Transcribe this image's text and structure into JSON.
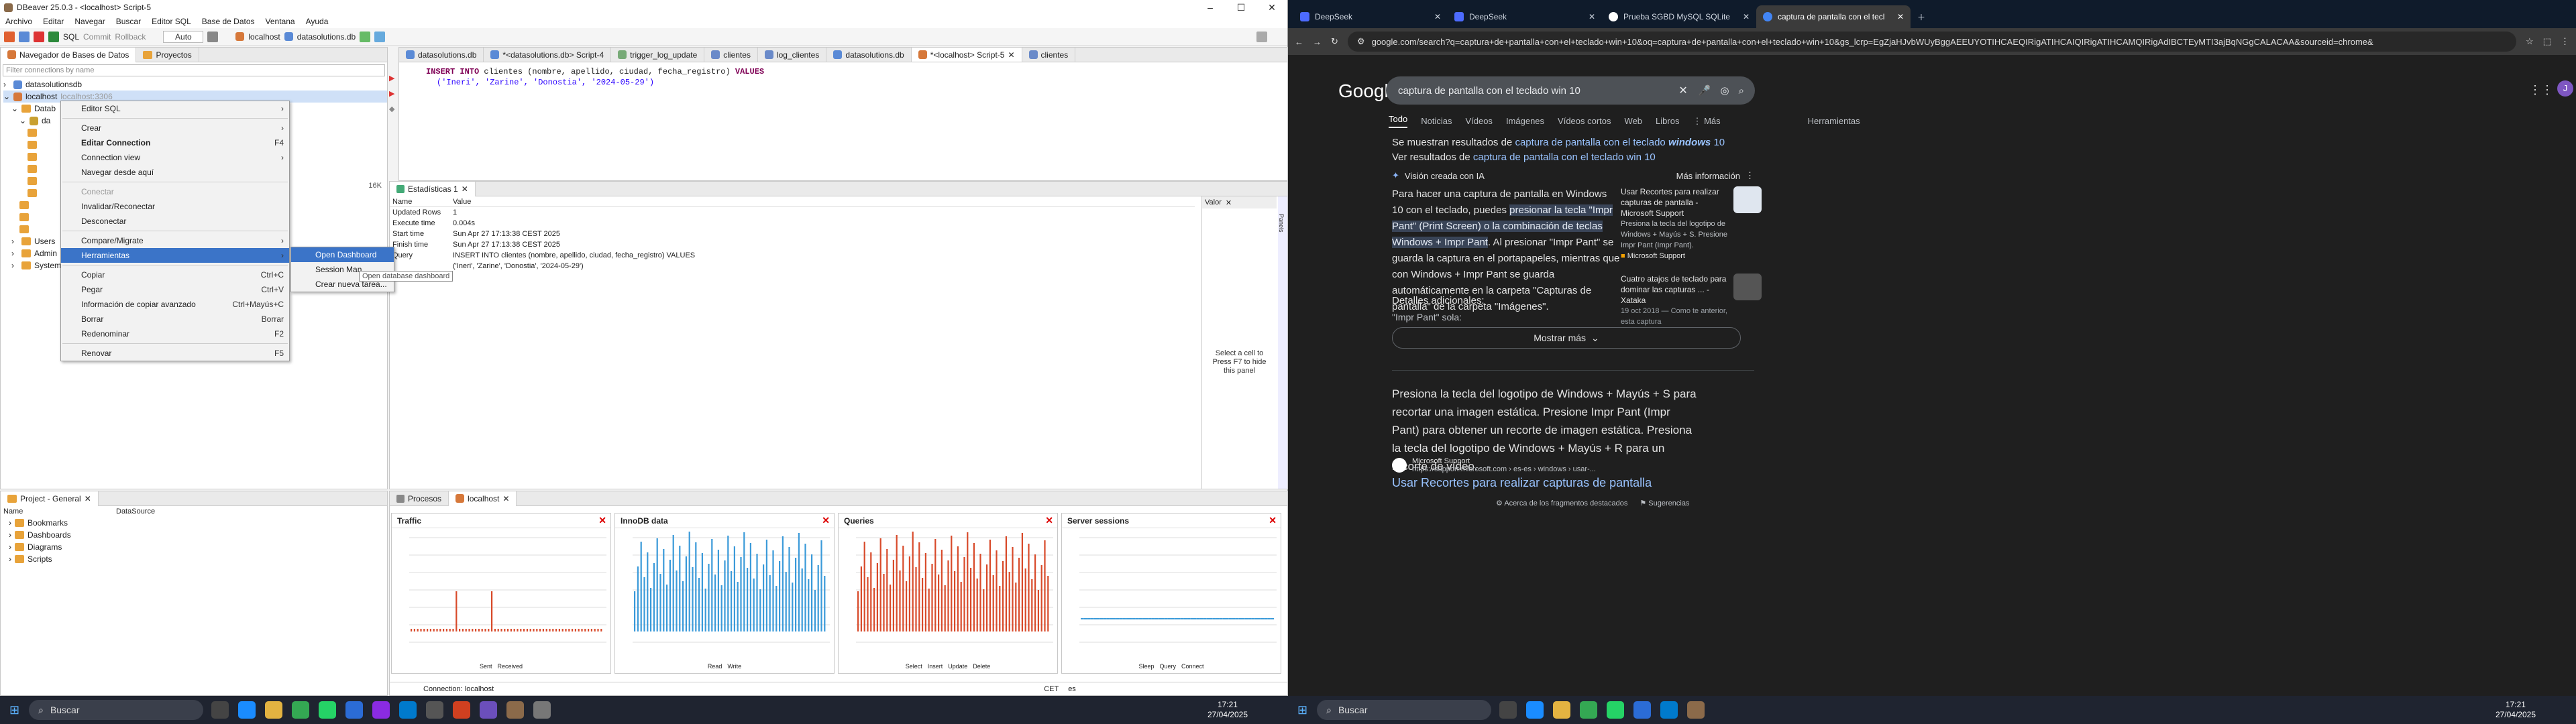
{
  "dbeaver": {
    "title": "DBeaver 25.0.3 - <localhost> Script-5",
    "menu": [
      "Archivo",
      "Editar",
      "Navegar",
      "Buscar",
      "Editor SQL",
      "Base de Datos",
      "Ventana",
      "Ayuda"
    ],
    "toolbar": {
      "sql": "SQL",
      "commit": "Commit",
      "rollback": "Rollback",
      "auto": "Auto",
      "conn": "localhost",
      "db": "datasolutions.db"
    },
    "nav": {
      "tab1": "Navegador de Bases de Datos",
      "tab2": "Proyectos",
      "filter": "Filter connections by name",
      "items": [
        "datasolutionsdb",
        "localhost",
        "Datab",
        "da",
        "Users",
        "Admin",
        "System"
      ],
      "localhost_suffix": "localhost:3306"
    },
    "editor_tabs": [
      "datasolutions.db",
      "*<datasolutions.db> Script-4",
      "trigger_log_update",
      "clientes",
      "log_clientes",
      "datasolutions.db",
      "*<localhost> Script-5",
      "clientes"
    ],
    "code": {
      "line1_kw": "INSERT INTO",
      "line1": " clientes (nombre, apellido, ciudad, fecha_registro) ",
      "line1_kw2": "VALUES",
      "line2": "('Ineri', 'Zarine', 'Donostia', '2024-05-29')"
    },
    "stats": {
      "tab": "Estadísticas 1",
      "col_name": "Name",
      "col_value": "Value",
      "rows": [
        [
          "Updated Rows",
          "1"
        ],
        [
          "Execute time",
          "0.004s"
        ],
        [
          "Start time",
          "Sun Apr 27 17:13:38 CEST 2025"
        ],
        [
          "Finish time",
          "Sun Apr 27 17:13:38 CEST 2025"
        ],
        [
          "Query",
          "INSERT INTO clientes (nombre, apellido, ciudad, fecha_registro) VALUES"
        ],
        [
          "",
          "('Ineri', 'Zarine', 'Donostia', '2024-05-29')"
        ]
      ],
      "value_tab": "Valor",
      "hint": "Select a cell to",
      "hint2": "Press F7 to hide",
      "hint3": "this panel",
      "side": "Panels",
      "size": "16K"
    },
    "ctx": {
      "items": [
        {
          "label": "Editor SQL",
          "sub": true
        },
        {
          "sep": true
        },
        {
          "label": "Crear",
          "sub": true
        },
        {
          "label": "Editar Connection",
          "sc": "F4",
          "bold": true
        },
        {
          "label": "Connection view",
          "sub": true
        },
        {
          "label": "Navegar desde aquí"
        },
        {
          "sep": true
        },
        {
          "label": "Conectar",
          "dis": true
        },
        {
          "label": "Invalidar/Reconectar"
        },
        {
          "label": "Desconectar"
        },
        {
          "sep": true
        },
        {
          "label": "Compare/Migrate",
          "sub": true
        },
        {
          "label": "Herramientas",
          "sub": true,
          "hl": true
        },
        {
          "sep": true
        },
        {
          "label": "Copiar",
          "sc": "Ctrl+C"
        },
        {
          "label": "Pegar",
          "sc": "Ctrl+V"
        },
        {
          "label": "Información de copiar avanzado",
          "sc": "Ctrl+Mayús+C"
        },
        {
          "label": "Borrar",
          "sc": "Borrar"
        },
        {
          "label": "Redenominar",
          "sc": "F2"
        },
        {
          "sep": true
        },
        {
          "label": "Renovar",
          "sc": "F5"
        }
      ],
      "sub": [
        "Open Dashboard",
        "Session Man",
        "Crear nueva tarea..."
      ],
      "tooltip": "Open database dashboard"
    },
    "project": {
      "tab": "Project - General",
      "col1": "Name",
      "col2": "DataSource",
      "items": [
        "Bookmarks",
        "Dashboards",
        "Diagrams",
        "Scripts"
      ]
    },
    "dash": {
      "tab1": "Procesos",
      "tab2": "localhost",
      "conn": "Connection: localhost",
      "cet": "CET",
      "lang": "es"
    },
    "charts": [
      {
        "title": "Traffic",
        "legend": [
          "Sent",
          "Received"
        ],
        "color": "#d84a2a"
      },
      {
        "title": "InnoDB data",
        "legend": [
          "Read",
          "Write"
        ],
        "color": "#3a9ad9"
      },
      {
        "title": "Queries",
        "legend": [
          "Select",
          "Insert",
          "Update",
          "Delete"
        ],
        "color": "#d84a2a"
      },
      {
        "title": "Server sessions",
        "legend": [
          "Sleep",
          "Query",
          "Connect"
        ],
        "color": "#3a9ad9"
      }
    ]
  },
  "chrome": {
    "tabs": [
      "DeepSeek",
      "DeepSeek",
      "Prueba SGBD MySQL SQLite",
      "captura de pantalla con el tecla"
    ],
    "url": "google.com/search?q=captura+de+pantalla+con+el+teclado+win+10&oq=captura+de+pantalla+con+el+teclado+win+10&gs_lcrp=EgZjaHJvbWUyBggAEEUYOTIHCAEQIRigATIHCAIQIRigATIHCAMQIRigAdIBCTEyMTI3ajBqNGgCALACAA&sourceid=chrome&",
    "query": "captura de pantalla con el teclado win 10",
    "filters": [
      "Todo",
      "Noticias",
      "Vídeos",
      "Imágenes",
      "Vídeos cortos",
      "Web",
      "Libros",
      "⋮ Más",
      "Herramientas"
    ],
    "showing": "Se muestran resultados de ",
    "showing_link": "captura de pantalla con el teclado ",
    "showing_bold": "windows",
    "showing_tail": " 10",
    "see_instead": "Ver resultados de ",
    "see_link": "captura de pantalla con el teclado win 10",
    "ai_label": "Visión creada con IA",
    "more_info": "Más información",
    "ai_p1a": "Para hacer una captura de pantalla en Windows 10 con el teclado, puedes ",
    "ai_p1b": "presionar la tecla \"Impr Pant\" (Print Screen) o la combinación de teclas Windows + Impr Pant",
    "ai_p1c": ". Al presionar \"Impr Pant\" se guarda la captura en el portapapeles, mientras que con Windows + Impr Pant se guarda automáticamente en la carpeta \"Capturas de pantalla\" de la carpeta \"Imágenes\".",
    "details": "Detalles adicionales:",
    "detail1": "\"Impr Pant\" sola:",
    "show_more": "Mostrar más",
    "side1_title": "Usar Recortes para realizar capturas de pantalla - Microsoft Support",
    "side1_text": "Presiona la tecla del logotipo de Windows + Mayús + S. Presione Impr Pant (Impr Pant).",
    "side1_src": "Microsoft Support",
    "side2_title": "Cuatro atajos de teclado para dominar las capturas ... - Xataka",
    "side2_date": "19 oct 2018 — Como te anterior, esta captura",
    "snippet": "Presiona la tecla del logotipo de Windows + Mayús + S para recortar una imagen estática. Presione Impr Pant (Impr Pant) para obtener un recorte de imagen estática. Presiona la tecla del logotipo de Windows + Mayús + R para un recorte de vídeo.",
    "res_src": "Microsoft Support",
    "res_url": "https://support.microsoft.com › es-es › windows › usar-...",
    "res_title": "Usar Recortes para realizar capturas de pantalla",
    "about": "Acerca de los fragmentos destacados",
    "feedback": "Sugerencias",
    "avatar": "J"
  },
  "taskbar": {
    "search": "Buscar",
    "time": "17:21",
    "date": "27/04/2025"
  }
}
